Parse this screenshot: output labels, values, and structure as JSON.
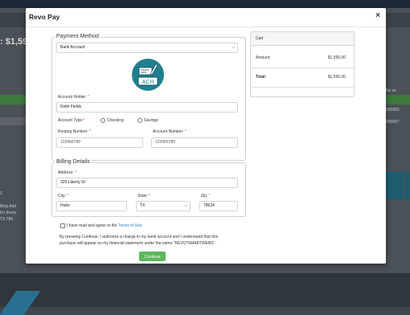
{
  "modal": {
    "title": "Revo Pay",
    "close_glyph": "×"
  },
  "background": {
    "price_fragment": ": $1,59",
    "right_texts": [
      "his wi",
      "000083",
      "000067"
    ],
    "left_texts": [
      "Z",
      "illing Add",
      "ld Liberty",
      "TX 786"
    ]
  },
  "payment": {
    "legend": "Payment Method",
    "method_select": "Bank Account",
    "logo_text": "ACH",
    "account_holder_label": "Account Holder:",
    "account_holder_value": "Keith Fields",
    "account_type_label": "Account Type:",
    "checking_label": "Checking",
    "savings_label": "Savings",
    "routing_label": "Routing Number:",
    "routing_placeholder": "123456789",
    "account_number_label": "Account Number:",
    "account_number_placeholder": "123456789",
    "required_mark": "*"
  },
  "billing": {
    "legend": "Billing Details",
    "address_label": "Address:",
    "address_value": "320 Liberty St",
    "city_label": "City:",
    "city_value": "Hutto",
    "state_label": "State:",
    "state_value": "TX",
    "zip_label": "Zip:",
    "zip_value": "78634"
  },
  "cart": {
    "title": "Cart",
    "amount_label": "Amount:",
    "amount_value": "$1,595.00",
    "total_label": "Total:",
    "total_value": "$1,595.00"
  },
  "terms": {
    "agree_text": "I have read and agree to the",
    "terms_link": "Terms of Use",
    "authorization_line1": "By pressing Continue, I authorize a charge to my bank account and I understand that this",
    "authorization_line2": "purchase will appear on my financial statement under the name \"REVO*SMARTWEBS\"."
  },
  "actions": {
    "continue_label": "Continue"
  },
  "colors": {
    "accent_green": "#5cb85c",
    "link_blue": "#2a7fc1",
    "required_red": "#d9534f",
    "ach_teal": "#1f7f8e"
  },
  "icons": {
    "close": "close-icon",
    "select_caret": "chevron-down-icon",
    "logo": "ach-check-icon"
  }
}
